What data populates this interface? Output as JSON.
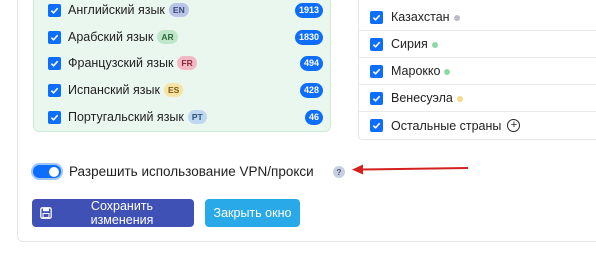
{
  "languages": [
    {
      "label": "Английский язык",
      "code": "EN",
      "count": "1913",
      "tag_bg": "#b9c4e6",
      "tag_fg": "#3a4a7a"
    },
    {
      "label": "Арабский язык",
      "code": "AR",
      "count": "1830",
      "tag_bg": "#bfe6c9",
      "tag_fg": "#2e6a3e"
    },
    {
      "label": "Французский язык",
      "code": "FR",
      "count": "494",
      "tag_bg": "#f2b8c3",
      "tag_fg": "#8a2a3d"
    },
    {
      "label": "Испанский язык",
      "code": "ES",
      "count": "428",
      "tag_bg": "#f7e3a6",
      "tag_fg": "#7a5a10"
    },
    {
      "label": "Португальский язык",
      "code": "PT",
      "count": "46",
      "tag_bg": "#bfd8f0",
      "tag_fg": "#2d527a"
    }
  ],
  "countries": [
    {
      "label": "Казахстан",
      "dot": "#b9bcc2"
    },
    {
      "label": "Сирия",
      "dot": "#8fd8a8"
    },
    {
      "label": "Марокко",
      "dot": "#8fd8a8"
    },
    {
      "label": "Венесуэла",
      "dot": "#f5d88a"
    },
    {
      "label": "Остальные страны",
      "dot": ""
    }
  ],
  "vpn": {
    "label": "Разрешить использование VPN/прокси",
    "enabled": true,
    "help": "?"
  },
  "buttons": {
    "save": "Сохранить изменения",
    "close": "Закрыть окно"
  },
  "colors": {
    "primary": "#0d6efd",
    "save": "#3f51b5",
    "close": "#29a9e8",
    "arrow": "#d32020"
  }
}
